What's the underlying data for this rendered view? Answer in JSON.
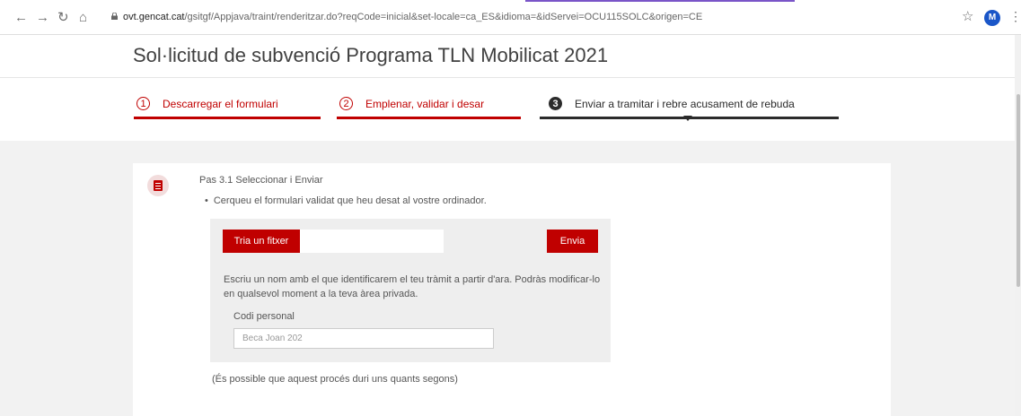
{
  "browser": {
    "url_domain": "ovt.gencat.cat",
    "url_path": "/gsitgf/Appjava/traint/renderitzar.do?reqCode=inicial&set-locale=ca_ES&idioma=&idServei=OCU115SOLC&origen=CE",
    "profile_initial": "M",
    "icons": [
      "back-icon",
      "forward-icon",
      "reload-icon",
      "home-icon",
      "lock-icon",
      "star-icon",
      "menu-icon"
    ]
  },
  "page": {
    "title": "Sol·licitud de subvenció Programa TLN Mobilicat 2021"
  },
  "steps": [
    {
      "number": "1",
      "label": "Descarregar el formulari",
      "state": "done"
    },
    {
      "number": "2",
      "label": "Emplenar, validar i desar",
      "state": "done"
    },
    {
      "number": "3",
      "label": "Enviar a tramitar i rebre acusament de rebuda",
      "state": "active"
    }
  ],
  "content": {
    "step_title": "Pas 3.1 Seleccionar i Enviar",
    "bullet": "Cerqueu el formulari validat que heu desat al vostre ordinador.",
    "choose_file_label": "Tria un fitxer",
    "send_label": "Envia",
    "description": "Escriu un nom amb el que identificarem el teu tràmit a partir d'ara. Podràs modificar-lo en qualsevol moment a la teva àrea privada.",
    "code_label": "Codi personal",
    "code_placeholder": "Beca Joan 202",
    "note": "(És possible que aquest procés duri uns quants segons)"
  },
  "colors": {
    "accent": "#c00000",
    "active_step": "#2b2b2b",
    "background": "#f2f2f2"
  }
}
